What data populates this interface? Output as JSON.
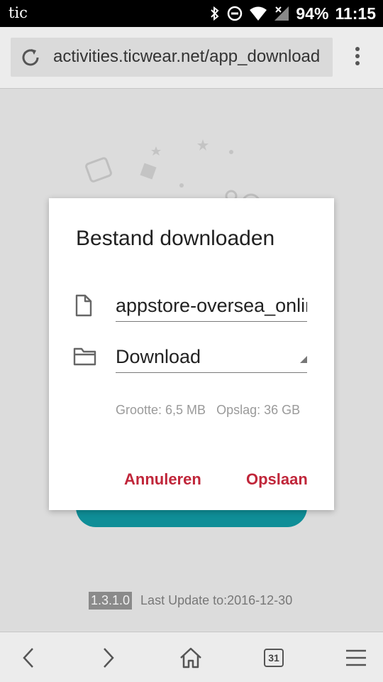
{
  "status_bar": {
    "carrier": "tic",
    "battery": "94%",
    "time": "11:15"
  },
  "browser": {
    "url": "activities.ticwear.net/app_download"
  },
  "page": {
    "version": "1.3.1.0",
    "last_update": "Last Update to:2016-12-30"
  },
  "dialog": {
    "title": "Bestand downloaden",
    "filename": "appstore-oversea_online.apk",
    "folder": "Download",
    "size": "Grootte: 6,5 MB",
    "storage": "Opslag: 36 GB",
    "cancel": "Annuleren",
    "save": "Opslaan"
  },
  "bottom_nav": {
    "tab_count": "31"
  },
  "colors": {
    "accent": "#c0263a",
    "teal": "#0f8e97"
  }
}
